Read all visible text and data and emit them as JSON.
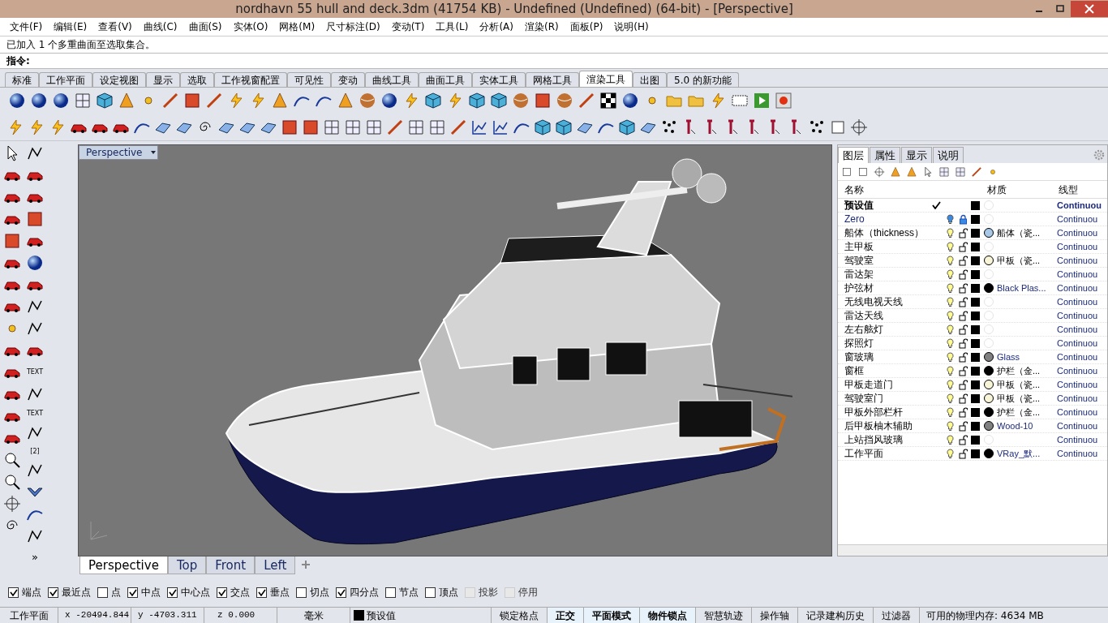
{
  "window": {
    "title": "nordhavn 55 hull and deck.3dm (41754 KB) - Undefined (Undefined) (64-bit) - [Perspective]"
  },
  "menu": [
    "文件(F)",
    "编辑(E)",
    "查看(V)",
    "曲线(C)",
    "曲面(S)",
    "实体(O)",
    "网格(M)",
    "尺寸标注(D)",
    "变动(T)",
    "工具(L)",
    "分析(A)",
    "渲染(R)",
    "面板(P)",
    "说明(H)"
  ],
  "command_history": "已加入 1 个多重曲面至选取集合。",
  "command_prompt": {
    "label": "指令:"
  },
  "toolbar_tabs": [
    {
      "label": "标准",
      "selected": false
    },
    {
      "label": "工作平面",
      "selected": false
    },
    {
      "label": "设定视图",
      "selected": false
    },
    {
      "label": "显示",
      "selected": false
    },
    {
      "label": "选取",
      "selected": false
    },
    {
      "label": "工作视窗配置",
      "selected": false
    },
    {
      "label": "可见性",
      "selected": false
    },
    {
      "label": "变动",
      "selected": false
    },
    {
      "label": "曲线工具",
      "selected": false
    },
    {
      "label": "曲面工具",
      "selected": false
    },
    {
      "label": "实体工具",
      "selected": false
    },
    {
      "label": "网格工具",
      "selected": false
    },
    {
      "label": "渲染工具",
      "selected": true
    },
    {
      "label": "出图",
      "selected": false
    },
    {
      "label": "5.0 的新功能",
      "selected": false
    }
  ],
  "left_toolbar": {
    "labels": [
      "TEXT",
      "TEXT",
      "[2]"
    ],
    "more": "»"
  },
  "viewport": {
    "label": "Perspective"
  },
  "viewport_tabs": [
    {
      "label": "Perspective",
      "selected": true
    },
    {
      "label": "Top",
      "selected": false
    },
    {
      "label": "Front",
      "selected": false
    },
    {
      "label": "Left",
      "selected": false
    }
  ],
  "layer_panel": {
    "tabs": [
      {
        "label": "图层",
        "selected": true
      },
      {
        "label": "属性",
        "selected": false
      },
      {
        "label": "显示",
        "selected": false
      },
      {
        "label": "说明",
        "selected": false
      }
    ],
    "columns": [
      "名称",
      "材质",
      "线型"
    ],
    "layers": [
      {
        "name": "预设值",
        "current": true,
        "linetype": "Continuou"
      },
      {
        "name": "Zero",
        "current": false,
        "locked": true,
        "linetype": "Continuou"
      },
      {
        "name": "船体（thickness）",
        "current": false,
        "locked": false,
        "material": {
          "name": "船体（瓷...",
          "color": "#a8c8e8"
        },
        "linetype": "Continuou"
      },
      {
        "name": "主甲板",
        "current": false,
        "locked": false,
        "linetype": "Continuou"
      },
      {
        "name": "驾驶室",
        "current": false,
        "locked": false,
        "material": {
          "name": "甲板（瓷...",
          "color": "#f8f4d8"
        },
        "linetype": "Continuou"
      },
      {
        "name": "雷达架",
        "current": false,
        "locked": false,
        "linetype": "Continuou"
      },
      {
        "name": "护弦材",
        "current": false,
        "locked": false,
        "material": {
          "name": "Black Plas...",
          "color": "#000000"
        },
        "linetype": "Continuou"
      },
      {
        "name": "无线电视天线",
        "current": false,
        "locked": false,
        "linetype": "Continuou"
      },
      {
        "name": "雷达天线",
        "current": false,
        "locked": false,
        "linetype": "Continuou"
      },
      {
        "name": "左右舷灯",
        "current": false,
        "locked": false,
        "linetype": "Continuou"
      },
      {
        "name": "探照灯",
        "current": false,
        "locked": false,
        "linetype": "Continuou"
      },
      {
        "name": "窗玻璃",
        "current": false,
        "locked": false,
        "material": {
          "name": "Glass",
          "color": "#808080"
        },
        "linetype": "Continuou"
      },
      {
        "name": "窗框",
        "current": false,
        "locked": false,
        "material": {
          "name": "护栏（金...",
          "color": "#000000"
        },
        "linetype": "Continuou"
      },
      {
        "name": "甲板走道门",
        "current": false,
        "locked": false,
        "material": {
          "name": "甲板（瓷...",
          "color": "#f8f4d8"
        },
        "linetype": "Continuou"
      },
      {
        "name": "驾驶室门",
        "current": false,
        "locked": false,
        "material": {
          "name": "甲板（瓷...",
          "color": "#f8f4d8"
        },
        "linetype": "Continuou"
      },
      {
        "name": "甲板外部栏杆",
        "current": false,
        "locked": false,
        "material": {
          "name": "护栏（金...",
          "color": "#000000"
        },
        "linetype": "Continuou"
      },
      {
        "name": "后甲板柚木辅助",
        "current": false,
        "locked": false,
        "material": {
          "name": "Wood-10",
          "color": "#808080"
        },
        "linetype": "Continuou"
      },
      {
        "name": "上站挡风玻璃",
        "current": false,
        "locked": false,
        "linetype": "Continuou"
      },
      {
        "name": "工作平面",
        "current": false,
        "locked": false,
        "material": {
          "name": "VRay_默...",
          "color": "#000000"
        },
        "linetype": "Continuou"
      }
    ]
  },
  "osnaps": [
    {
      "label": "端点",
      "checked": true,
      "disabled": false
    },
    {
      "label": "最近点",
      "checked": true,
      "disabled": false
    },
    {
      "label": "点",
      "checked": false,
      "disabled": false
    },
    {
      "label": "中点",
      "checked": true,
      "disabled": false
    },
    {
      "label": "中心点",
      "checked": true,
      "disabled": false
    },
    {
      "label": "交点",
      "checked": true,
      "disabled": false
    },
    {
      "label": "垂点",
      "checked": true,
      "disabled": false
    },
    {
      "label": "切点",
      "checked": false,
      "disabled": false
    },
    {
      "label": "四分点",
      "checked": true,
      "disabled": false
    },
    {
      "label": "节点",
      "checked": false,
      "disabled": false
    },
    {
      "label": "顶点",
      "checked": false,
      "disabled": false
    },
    {
      "label": "投影",
      "checked": false,
      "disabled": true
    },
    {
      "label": "停用",
      "checked": false,
      "disabled": true
    }
  ],
  "status_bar": {
    "cplane": "工作平面",
    "x": "x -20494.844",
    "y": "y -4703.311",
    "z": "z 0.000",
    "units": "毫米",
    "layer": "预设值",
    "toggles": [
      {
        "label": "锁定格点",
        "on": false
      },
      {
        "label": "正交",
        "on": true
      },
      {
        "label": "平面模式",
        "on": true
      },
      {
        "label": "物件锁点",
        "on": true
      },
      {
        "label": "智慧轨迹",
        "on": false
      },
      {
        "label": "操作轴",
        "on": false
      },
      {
        "label": "记录建构历史",
        "on": false
      },
      {
        "label": "过滤器",
        "on": false
      }
    ],
    "memory": "可用的物理内存: 4634 MB"
  }
}
